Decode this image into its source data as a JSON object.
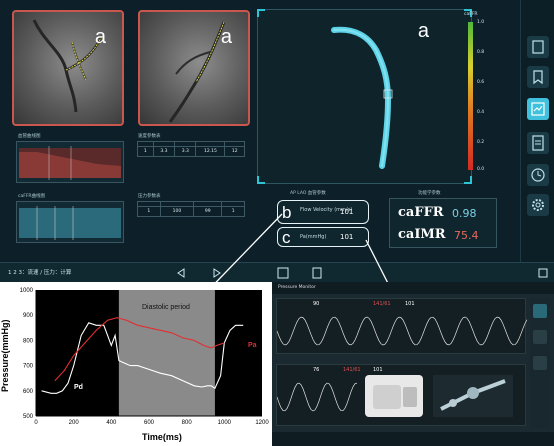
{
  "angio": {
    "left_letter": "a",
    "right_letter": "a"
  },
  "render3d": {
    "letter": "a",
    "colorbar_title": "caFFR",
    "colorbar_ticks": [
      "1.0",
      "0.8",
      "0.6",
      "0.4",
      "0.2",
      "0.0"
    ]
  },
  "panels": {
    "left1_label": "血管曲线图",
    "left2_label": "caFFR曲线图",
    "table1_label": "速度参数表",
    "table2_label": "压力参数表",
    "table1_rows": [
      [
        "",
        "",
        "",
        "",
        ""
      ],
      [
        "1",
        "3.3",
        "3.3",
        "12.15",
        "12"
      ]
    ],
    "table2_rows": [
      [
        "",
        "",
        "",
        ""
      ],
      [
        "1",
        "100",
        "99",
        "1"
      ]
    ]
  },
  "bubbles": {
    "b_letter": "b",
    "b_label": "Flow Velocity (mm/s)",
    "b_value": "101",
    "c_letter": "c",
    "c_label": "Pa(mmHg)",
    "c_value": "101",
    "header_labels": "AP   LAO   血管参数",
    "results_header": "功能学参数"
  },
  "results": {
    "cafff_name": "caFFR",
    "cafff_value": "0.98",
    "caimr_name": "caIMR",
    "caimr_value": "75.4"
  },
  "strip": {
    "steps": "1   2   3：流速 / 压力：计算"
  },
  "pressure_chart": {
    "ylabel": "Pressure(mmHg)",
    "xlabel": "Time(ms)",
    "annotation": "Diastolic period",
    "label_pd": "Pd",
    "label_pa": "Pa"
  },
  "chart_data": {
    "type": "line",
    "xlabel": "Time(ms)",
    "ylabel": "Pressure(mmHg)",
    "xlim": [
      0,
      1200
    ],
    "ylim": [
      500,
      1000
    ],
    "x_ticks": [
      0,
      200,
      400,
      600,
      800,
      1000,
      1200
    ],
    "y_ticks": [
      500,
      600,
      700,
      800,
      900,
      1000
    ],
    "shaded_region": [
      440,
      950
    ],
    "annotation": "Diastolic period",
    "series": [
      {
        "name": "Pd",
        "color": "#000000",
        "x": [
          30,
          80,
          110,
          140,
          170,
          200,
          240,
          280,
          320,
          360,
          380,
          400,
          420,
          440,
          470,
          500,
          540,
          600,
          660,
          720,
          780,
          840,
          880,
          910,
          930,
          950,
          980,
          1000,
          1030,
          1060,
          1100
        ],
        "y": [
          600,
          590,
          590,
          600,
          630,
          700,
          820,
          870,
          860,
          860,
          820,
          780,
          820,
          720,
          710,
          700,
          700,
          685,
          670,
          660,
          640,
          620,
          615,
          620,
          620,
          610,
          660,
          790,
          840,
          860,
          860
        ]
      },
      {
        "name": "Pa",
        "color": "#e03030",
        "x": [
          100,
          150,
          200,
          260,
          320,
          380,
          430,
          480,
          540,
          600,
          660,
          720,
          780,
          840,
          890,
          930,
          960,
          1000
        ],
        "y": [
          640,
          680,
          740,
          790,
          840,
          880,
          890,
          880,
          860,
          850,
          840,
          830,
          810,
          800,
          780,
          770,
          780,
          790
        ]
      }
    ]
  },
  "monitor": {
    "title": "Pressure Monitor",
    "hr1": "90",
    "bp1": "141/61",
    "map1": "101",
    "hr2": "76",
    "bp2": "141/61",
    "map2": "101"
  }
}
